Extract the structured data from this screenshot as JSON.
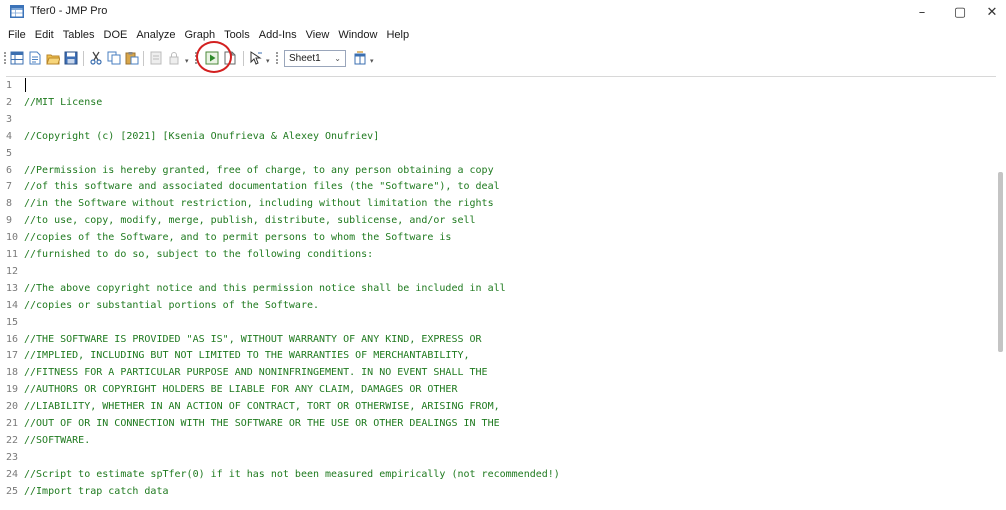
{
  "window": {
    "title": "Tfer0 - JMP Pro",
    "min_glyph": "–",
    "max_glyph": "▢",
    "close_glyph": "✕"
  },
  "menu": [
    "File",
    "Edit",
    "Tables",
    "DOE",
    "Analyze",
    "Graph",
    "Tools",
    "Add-Ins",
    "View",
    "Window",
    "Help"
  ],
  "toolbar": {
    "table_select": "Sheet1",
    "table_select_arrow": "⌄",
    "dropdown_glyph": "▾"
  },
  "highlight_color": "#d32020",
  "editor": {
    "lines": [
      {
        "n": "1",
        "text": ""
      },
      {
        "n": "2",
        "text": "//MIT License"
      },
      {
        "n": "3",
        "text": ""
      },
      {
        "n": "4",
        "text": "//Copyright (c) [2021] [Ksenia Onufrieva & Alexey Onufriev]"
      },
      {
        "n": "5",
        "text": ""
      },
      {
        "n": "6",
        "text": "//Permission is hereby granted, free of charge, to any person obtaining a copy"
      },
      {
        "n": "7",
        "text": "//of this software and associated documentation files (the \"Software\"), to deal"
      },
      {
        "n": "8",
        "text": "//in the Software without restriction, including without limitation the rights"
      },
      {
        "n": "9",
        "text": "//to use, copy, modify, merge, publish, distribute, sublicense, and/or sell"
      },
      {
        "n": "10",
        "text": "//copies of the Software, and to permit persons to whom the Software is"
      },
      {
        "n": "11",
        "text": "//furnished to do so, subject to the following conditions:"
      },
      {
        "n": "12",
        "text": ""
      },
      {
        "n": "13",
        "text": "//The above copyright notice and this permission notice shall be included in all"
      },
      {
        "n": "14",
        "text": "//copies or substantial portions of the Software."
      },
      {
        "n": "15",
        "text": ""
      },
      {
        "n": "16",
        "text": "//THE SOFTWARE IS PROVIDED \"AS IS\", WITHOUT WARRANTY OF ANY KIND, EXPRESS OR"
      },
      {
        "n": "17",
        "text": "//IMPLIED, INCLUDING BUT NOT LIMITED TO THE WARRANTIES OF MERCHANTABILITY,"
      },
      {
        "n": "18",
        "text": "//FITNESS FOR A PARTICULAR PURPOSE AND NONINFRINGEMENT. IN NO EVENT SHALL THE"
      },
      {
        "n": "19",
        "text": "//AUTHORS OR COPYRIGHT HOLDERS BE LIABLE FOR ANY CLAIM, DAMAGES OR OTHER"
      },
      {
        "n": "20",
        "text": "//LIABILITY, WHETHER IN AN ACTION OF CONTRACT, TORT OR OTHERWISE, ARISING FROM,"
      },
      {
        "n": "21",
        "text": "//OUT OF OR IN CONNECTION WITH THE SOFTWARE OR THE USE OR OTHER DEALINGS IN THE"
      },
      {
        "n": "22",
        "text": "//SOFTWARE."
      },
      {
        "n": "23",
        "text": ""
      },
      {
        "n": "24",
        "text": "//Script to estimate spTfer(0) if it has not been measured empirically (not recommended!)"
      },
      {
        "n": "25",
        "text": "//Import trap catch data"
      }
    ]
  }
}
